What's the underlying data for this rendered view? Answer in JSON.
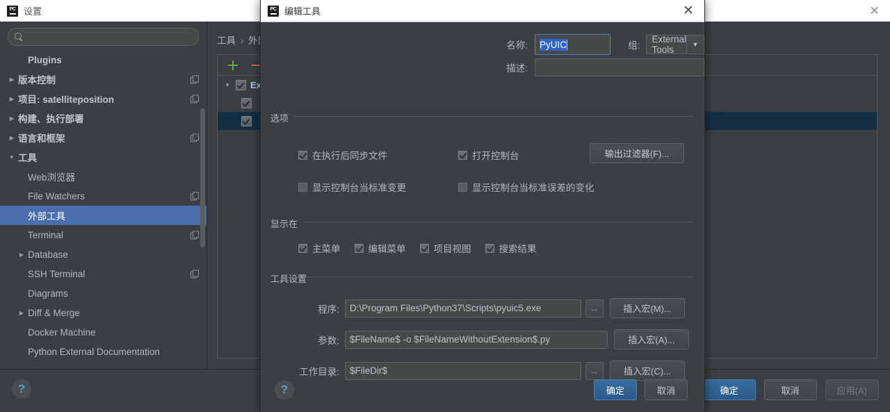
{
  "settings_window": {
    "title": "设置",
    "icon": "pycharm-logo-icon",
    "close_icon": "close-icon",
    "search": {
      "value": "",
      "placeholder": "",
      "icon": "search-icon"
    },
    "sidebar": {
      "items": [
        {
          "label": "Plugins",
          "arrow": "",
          "bold": true,
          "indent": 1,
          "copy": false,
          "selected": false
        },
        {
          "label": "版本控制",
          "arrow": "▶",
          "bold": true,
          "indent": 0,
          "copy": true,
          "selected": false
        },
        {
          "label": "项目: satelliteposition",
          "arrow": "▶",
          "bold": true,
          "indent": 0,
          "copy": true,
          "selected": false
        },
        {
          "label": "构建、执行部署",
          "arrow": "▶",
          "bold": true,
          "indent": 0,
          "copy": false,
          "selected": false
        },
        {
          "label": "语言和框架",
          "arrow": "▶",
          "bold": true,
          "indent": 0,
          "copy": true,
          "selected": false
        },
        {
          "label": "工具",
          "arrow": "▼",
          "bold": true,
          "indent": 0,
          "copy": false,
          "selected": false
        },
        {
          "label": "Web浏览器",
          "arrow": "",
          "bold": false,
          "indent": 1,
          "copy": false,
          "selected": false
        },
        {
          "label": "File Watchers",
          "arrow": "",
          "bold": false,
          "indent": 1,
          "copy": true,
          "selected": false
        },
        {
          "label": "外部工具",
          "arrow": "",
          "bold": false,
          "indent": 1,
          "copy": false,
          "selected": true
        },
        {
          "label": "Terminal",
          "arrow": "",
          "bold": false,
          "indent": 1,
          "copy": true,
          "selected": false
        },
        {
          "label": "Database",
          "arrow": "▶",
          "bold": false,
          "indent": 1,
          "copy": false,
          "selected": false
        },
        {
          "label": "SSH Terminal",
          "arrow": "",
          "bold": false,
          "indent": 1,
          "copy": true,
          "selected": false
        },
        {
          "label": "Diagrams",
          "arrow": "",
          "bold": false,
          "indent": 1,
          "copy": false,
          "selected": false
        },
        {
          "label": "Diff & Merge",
          "arrow": "▶",
          "bold": false,
          "indent": 1,
          "copy": false,
          "selected": false
        },
        {
          "label": "Docker Machine",
          "arrow": "",
          "bold": false,
          "indent": 1,
          "copy": false,
          "selected": false
        },
        {
          "label": "Python External Documentation",
          "arrow": "",
          "bold": false,
          "indent": 1,
          "copy": false,
          "selected": false
        }
      ]
    },
    "breadcrumb": {
      "part1": "工具",
      "separator": "›",
      "part2": "外部工具"
    },
    "toolbar": {
      "add_icon": "plus-icon",
      "remove_icon": "minus-icon"
    },
    "tool_tree": [
      {
        "label": "External Tools",
        "arrow": "▼",
        "checked": true,
        "group": true,
        "selected": false
      },
      {
        "label": "",
        "arrow": "",
        "checked": true,
        "group": false,
        "selected": false
      },
      {
        "label": "",
        "arrow": "",
        "checked": true,
        "group": false,
        "selected": true
      }
    ],
    "help_label": "?",
    "buttons": {
      "ok": "确定",
      "cancel": "取消",
      "apply": "应用(A)"
    }
  },
  "modal": {
    "title": "编辑工具",
    "icon": "pycharm-logo-icon",
    "close_icon": "close-icon",
    "name_label": "名称:",
    "name_value": "PyUIC",
    "group_label": "组:",
    "group_value": "External Tools",
    "group_arrow_icon": "chevron-down-icon",
    "desc_label": "描述:",
    "desc_value": "",
    "options": {
      "title": "选项",
      "sync_files": {
        "label": "在执行后同步文件",
        "checked": true
      },
      "open_console": {
        "label": "打开控制台",
        "checked": true
      },
      "show_stdout": {
        "label": "显示控制台当标准变更",
        "checked": false
      },
      "show_stderr": {
        "label": "显示控制台当标准误差的变化",
        "checked": false
      },
      "output_filters": "输出过滤器(F)..."
    },
    "show_in": {
      "title": "显示在",
      "items": [
        {
          "label": "主菜单",
          "checked": true
        },
        {
          "label": "编辑菜单",
          "checked": true
        },
        {
          "label": "项目视图",
          "checked": true
        },
        {
          "label": "搜索结果",
          "checked": true
        }
      ]
    },
    "tool_settings": {
      "title": "工具设置",
      "program_label": "程序:",
      "program_value": "D:\\Program Files\\Python37\\Scripts\\pyuic5.exe",
      "program_browse": "...",
      "program_macro": "插入宏(M)...",
      "args_label": "参数:",
      "args_value": "$FileName$ -o $FileNameWithoutExtension$.py",
      "args_macro": "插入宏(A)...",
      "workdir_label": "工作目录:",
      "workdir_value": "$FileDir$",
      "workdir_browse": "...",
      "workdir_macro": "插入宏(C)..."
    },
    "help_label": "?",
    "buttons": {
      "ok": "确定",
      "cancel": "取消"
    }
  },
  "colors": {
    "window_bg": "#3c3f41",
    "titlebar_bg": "#ffffff",
    "accent_selection": "#4b6eaf",
    "row_selected": "#132f45",
    "primary_button": "#2d5b89",
    "text_selection": "#2f65ca",
    "add_icon": "#6aa84f",
    "remove_icon": "#d0635c",
    "link_blue": "#5f9ed1"
  }
}
